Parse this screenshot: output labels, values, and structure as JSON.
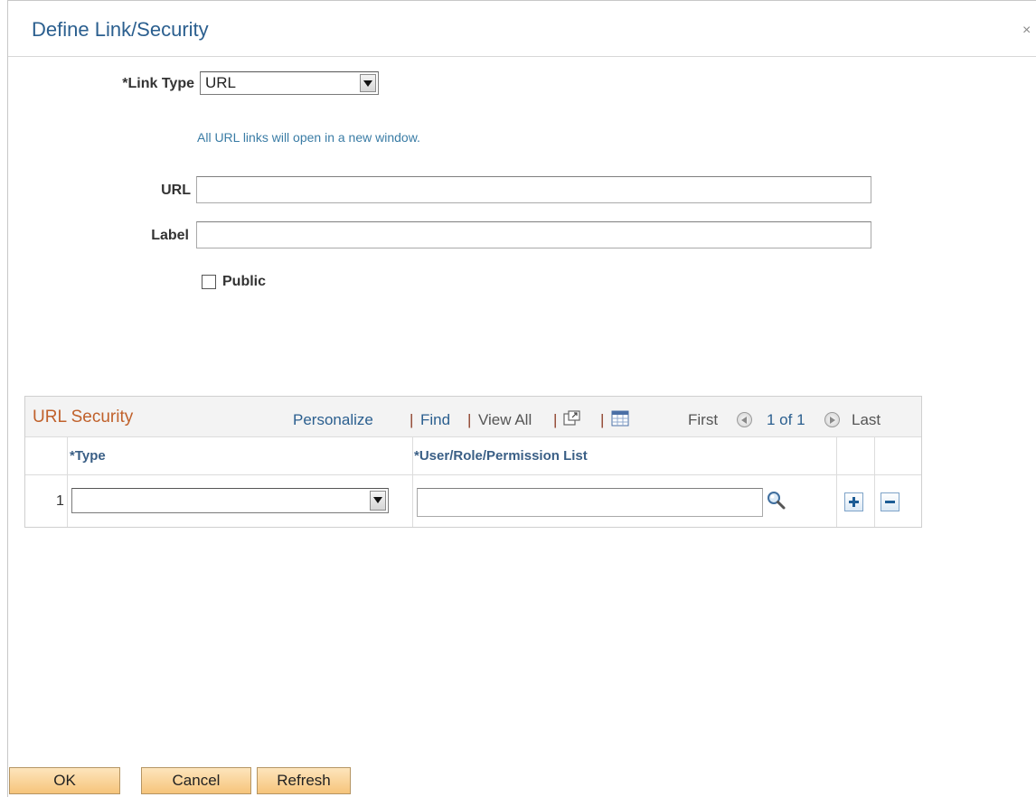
{
  "dialog": {
    "title": "Define Link/Security",
    "close_glyph": "×"
  },
  "form": {
    "link_type_label": "*Link Type",
    "link_type_value": "URL",
    "info_text": "All URL links will open in a new window.",
    "url_label": "URL",
    "url_value": "",
    "label_label": "Label",
    "label_value": "",
    "public_label": "Public",
    "public_checked": false
  },
  "grid": {
    "title": "URL Security",
    "personalize": "Personalize",
    "find": "Find",
    "view_all": "View All",
    "separator": "|",
    "first": "First",
    "page_count": "1 of 1",
    "last": "Last",
    "columns": [
      "*Type",
      "*User/Role/Permission List"
    ],
    "rows": [
      {
        "num": "1",
        "type": "",
        "user_role": ""
      }
    ],
    "icons": [
      "new-window-icon",
      "download-spreadsheet-icon",
      "prev-page-icon",
      "next-page-icon",
      "lookup-magnifier-icon",
      "add-row-icon",
      "delete-row-icon"
    ]
  },
  "buttons": {
    "ok": "OK",
    "cancel": "Cancel",
    "refresh": "Refresh"
  },
  "colors": {
    "title": "#2b5f8f",
    "grid_title": "#c0612b",
    "button_bg": "#f6c47b"
  }
}
